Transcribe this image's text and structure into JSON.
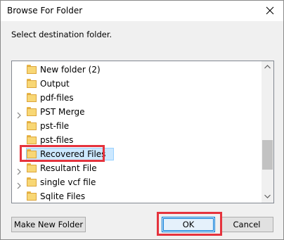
{
  "window": {
    "title": "Browse For Folder",
    "close_icon": "close-icon"
  },
  "prompt": "Select destination folder.",
  "tree": {
    "items": [
      {
        "label": "New folder (2)",
        "expandable": false,
        "selected": false
      },
      {
        "label": "Output",
        "expandable": false,
        "selected": false
      },
      {
        "label": "pdf-files",
        "expandable": false,
        "selected": false
      },
      {
        "label": "PST Merge",
        "expandable": true,
        "selected": false
      },
      {
        "label": "pst-file",
        "expandable": false,
        "selected": false
      },
      {
        "label": "pst-files",
        "expandable": false,
        "selected": false
      },
      {
        "label": "Recovered Files",
        "expandable": false,
        "selected": true
      },
      {
        "label": "Resultant File",
        "expandable": true,
        "selected": false
      },
      {
        "label": "single vcf file",
        "expandable": true,
        "selected": false
      },
      {
        "label": "Sqlite Files",
        "expandable": false,
        "selected": false
      }
    ]
  },
  "buttons": {
    "new_folder": "Make New Folder",
    "ok": "OK",
    "cancel": "Cancel"
  },
  "colors": {
    "highlight": "#e5333d",
    "selection": "#cce8ff",
    "folder": "#f8d775"
  }
}
